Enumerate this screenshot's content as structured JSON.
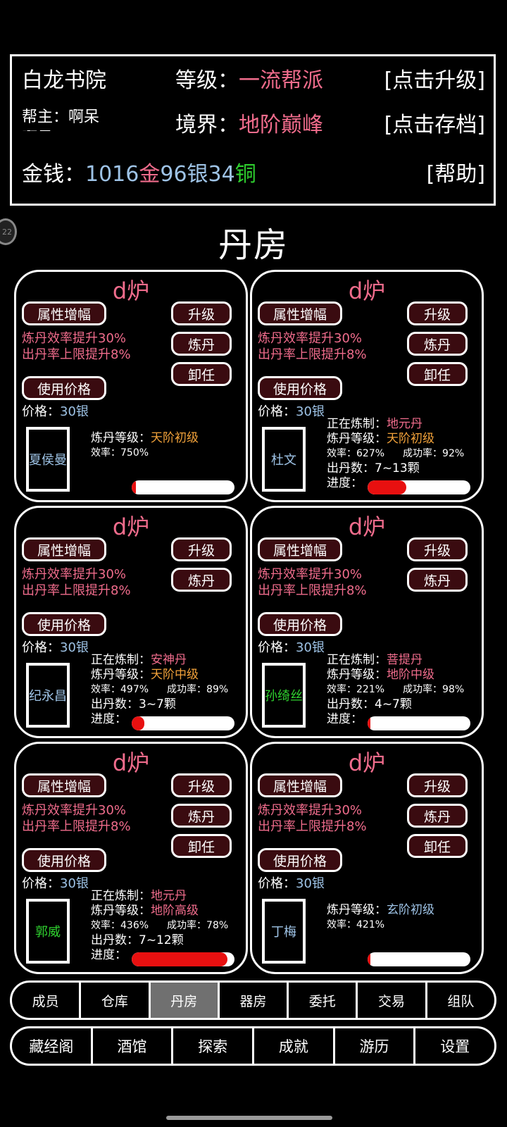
{
  "header": {
    "guild_name": "白龙书院",
    "level_label": "等级：",
    "level_value": "一流帮派",
    "upgrade_link": "[点击升级]",
    "leader_label": "帮主：啊呆",
    "leader_overflow": "啊呆",
    "realm_label": "境界：",
    "realm_value": "地阶巅峰",
    "save_link": "[点击存档]",
    "money_label": "金钱：",
    "gold_amount": "1016",
    "gold_unit": "金",
    "silver_amount": "96",
    "silver_unit": "银",
    "copper_amount": "34",
    "copper_unit": "铜",
    "help_link": "[帮助]"
  },
  "side_badge": "22",
  "page_title": "丹房",
  "labels": {
    "attr_btn": "属性增幅",
    "price_btn": "使用价格",
    "upgrade_btn": "升级",
    "make_btn": "炼丹",
    "fire_btn": "卸任",
    "eff1": "炼丹效率提升30%",
    "eff2": "出丹率上限提升8%",
    "price_label": "价格：",
    "price_num": "30",
    "price_unit": "银",
    "making_label": "正在炼制：",
    "rank_label": "炼丹等级：",
    "eff_label": "效率：",
    "rate_label": "成功率：",
    "yield_label": "出丹数：",
    "progress_label": "进度："
  },
  "furnaces": [
    {
      "title": "d炉",
      "has_fire": true,
      "worker": "夏侯曼",
      "worker_color": "blue",
      "making": "",
      "rank": "天阶初级",
      "rank_color": "#f2a23a",
      "efficiency": "750%",
      "success": "",
      "yield": "",
      "progress": 0.04
    },
    {
      "title": "d炉",
      "has_fire": true,
      "worker": "杜文",
      "worker_color": "blue",
      "making": "地元丹",
      "rank": "天阶初级",
      "rank_color": "#f2a23a",
      "efficiency": "627%",
      "success": "92%",
      "yield": "7~13颗",
      "progress": 0.38
    },
    {
      "title": "d炉",
      "has_fire": false,
      "worker": "纪永昌",
      "worker_color": "blue",
      "making": "安神丹",
      "rank": "天阶中级",
      "rank_color": "#f2a23a",
      "efficiency": "497%",
      "success": "89%",
      "yield": "3~7颗",
      "progress": 0.12
    },
    {
      "title": "d炉",
      "has_fire": false,
      "worker": "孙绮丝",
      "worker_color": "green",
      "making": "菩提丹",
      "rank": "地阶中级",
      "rank_color": "#f06c8c",
      "efficiency": "221%",
      "success": "98%",
      "yield": "4~7颗",
      "progress": 0.03
    },
    {
      "title": "d炉",
      "has_fire": true,
      "worker": "郭威",
      "worker_color": "green",
      "making": "地元丹",
      "rank": "地阶高级",
      "rank_color": "#f06c8c",
      "efficiency": "436%",
      "success": "78%",
      "yield": "7~12颗",
      "progress": 0.93
    },
    {
      "title": "d炉",
      "has_fire": true,
      "worker": "丁梅",
      "worker_color": "blue",
      "making": "",
      "rank": "玄阶初级",
      "rank_color": "#9ec3e6",
      "efficiency": "421%",
      "success": "",
      "yield": "",
      "progress": 0.03
    }
  ],
  "tabs_row1": [
    "成员",
    "仓库",
    "丹房",
    "器房",
    "委托",
    "交易",
    "组队"
  ],
  "active_tab": "丹房",
  "tabs_row2": [
    "藏经阁",
    "酒馆",
    "探索",
    "成就",
    "游历",
    "设置"
  ]
}
